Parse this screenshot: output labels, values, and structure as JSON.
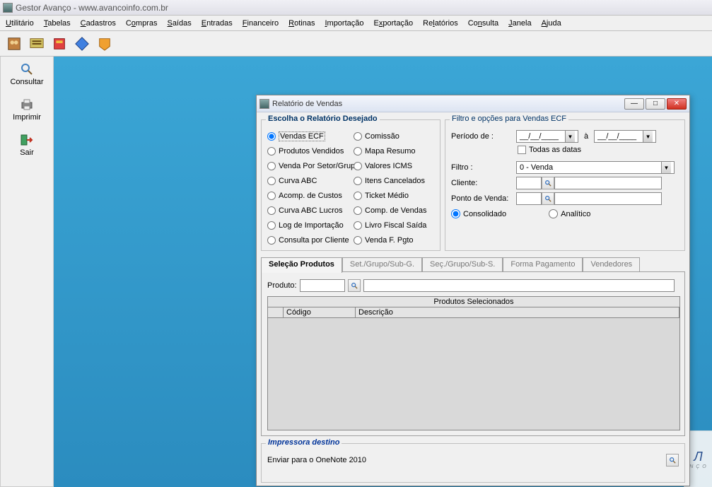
{
  "window": {
    "title": "Gestor Avanço - www.avancoinfo.com.br"
  },
  "menu": {
    "utilitario": "Utilitário",
    "tabelas": "Tabelas",
    "cadastros": "Cadastros",
    "compras": "Compras",
    "saidas": "Saídas",
    "entradas": "Entradas",
    "financeiro": "Financeiro",
    "rotinas": "Rotinas",
    "importacao": "Importação",
    "exportacao": "Exportação",
    "relatorios": "Relatórios",
    "consulta": "Consulta",
    "janela": "Janela",
    "ajuda": "Ajuda"
  },
  "sidebar": {
    "consultar": "Consultar",
    "imprimir": "Imprimir",
    "sair": "Sair"
  },
  "dialog": {
    "title": "Relatório de Vendas",
    "report_group": "Escolha o Relatório Desejado",
    "reports_left": [
      "Vendas ECF",
      "Produtos Vendidos",
      "Venda Por Setor/Grupo",
      "Curva ABC",
      "Acomp. de Custos",
      "Curva ABC Lucros",
      "Log de Importação",
      "Consulta por Cliente"
    ],
    "reports_right": [
      "Comissão",
      "Mapa Resumo",
      "Valores ICMS",
      "Itens Cancelados",
      "Ticket Médio",
      "Comp. de Vendas",
      "Livro Fiscal Saída",
      "Venda F. Pgto"
    ],
    "filter_group": "Filtro e opções para Vendas ECF",
    "periodo_label": "Período de  :",
    "date_placeholder": "__/__/____",
    "a_label": "à",
    "todas_datas": "Todas as datas",
    "filtro_label": "Filtro :",
    "filtro_value": "0 - Venda",
    "cliente_label": "Cliente:",
    "pdv_label": "Ponto de Venda:",
    "consolidado": "Consolidado",
    "analitico": "Analítico",
    "tabs": [
      "Seleção Produtos",
      "Set./Grupo/Sub-G.",
      "Seç./Grupo/Sub-S.",
      "Forma Pagamento",
      "Vendedores"
    ],
    "produto_label": "Produto:",
    "grid_title": "Produtos Selecionados",
    "col_codigo": "Código",
    "col_descricao": "Descrição",
    "printer_group": "Impressora destino",
    "printer_value": "Enviar para o OneNote 2010"
  }
}
